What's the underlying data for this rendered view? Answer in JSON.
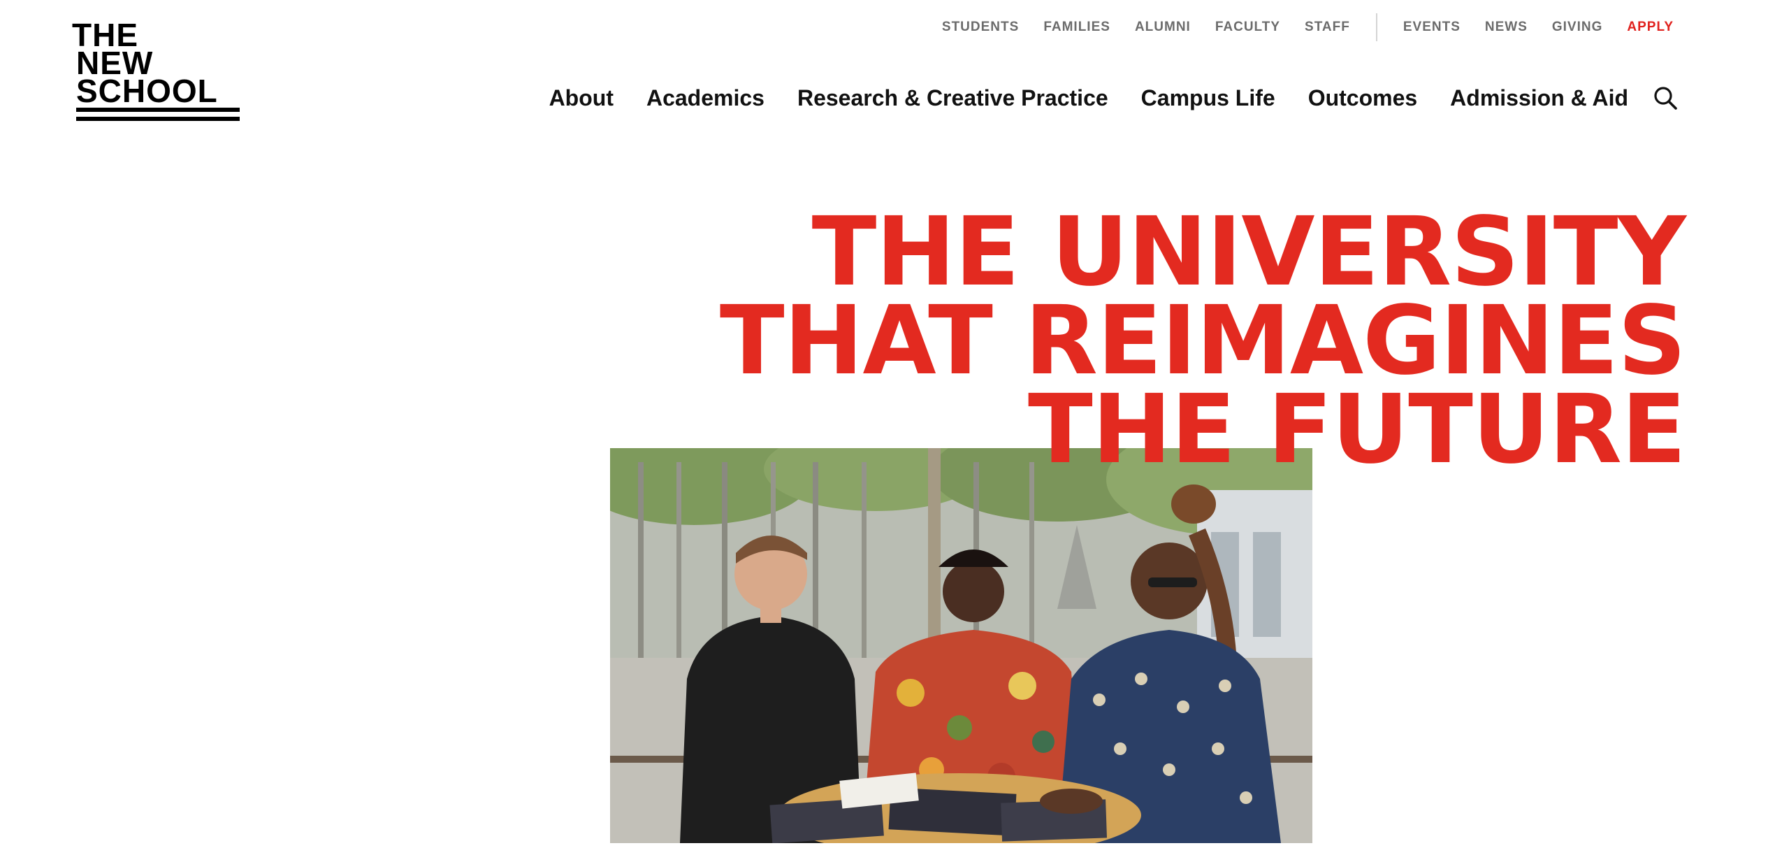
{
  "logo": {
    "lines": [
      "THE",
      "NEW",
      "SCHOOL"
    ]
  },
  "utility_nav": {
    "audience": [
      "STUDENTS",
      "FAMILIES",
      "ALUMNI",
      "FACULTY",
      "STAFF"
    ],
    "links": [
      "EVENTS",
      "NEWS",
      "GIVING"
    ],
    "apply": "APPLY",
    "apply_color": "#e0211d"
  },
  "main_nav": {
    "items": [
      "About",
      "Academics",
      "Research & Creative Practice",
      "Campus Life",
      "Outcomes",
      "Admission & Aid"
    ],
    "search_icon": "search-icon"
  },
  "hero": {
    "title_lines": [
      "THE UNIVERSITY",
      "THAT REIMAGINES",
      "THE FUTURE"
    ],
    "title_color": "#e32a20"
  },
  "colors": {
    "accent": "#e32a20",
    "text": "#111111",
    "utility_text": "#6b6b6b",
    "background": "#ffffff"
  }
}
